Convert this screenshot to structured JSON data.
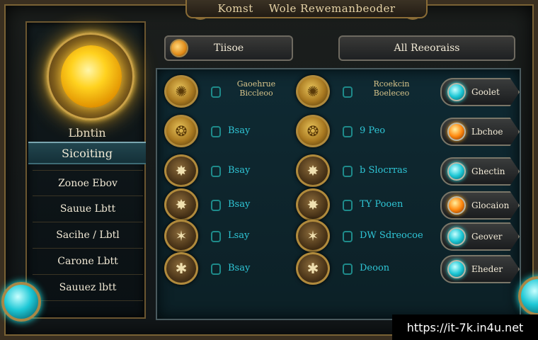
{
  "title": {
    "left": "Komst",
    "right": "Wole Rewemanbeoder"
  },
  "left_panel": {
    "heading": "Lbntin",
    "selected": "Sicoiting",
    "items": [
      {
        "label": "Zonoe Ebov"
      },
      {
        "label": "Sauue Lbtt"
      },
      {
        "label": "Sacihe / Lbtl"
      },
      {
        "label": "Carone Lbtt"
      },
      {
        "label": "Sauuez lbtt"
      }
    ]
  },
  "headers": {
    "left": "Tiisoe",
    "right": "All Reeoraiss"
  },
  "rows": [
    {
      "medal_a": "✺",
      "text_a": "Gaoehrue\nBiccleoo",
      "medal_b": "✺",
      "text_b": "Rcoekcin\nBoeleceo",
      "pill": "Goolet",
      "pill_gem": "teal"
    },
    {
      "medal_a": "❂",
      "text_a": "Bsay",
      "medal_b": "❂",
      "text_b": "9 Peo",
      "pill": "Lbchoe",
      "pill_gem": "amber"
    },
    {
      "medal_a": "✸",
      "text_a": "Bsay",
      "medal_b": "✸",
      "text_b": "b Slocrras",
      "pill": "Ghectin",
      "pill_gem": "teal"
    },
    {
      "medal_a": "✸",
      "text_a": "Bsay",
      "medal_b": "✸",
      "text_b": "TY Pooen",
      "pill": "Glocaion",
      "pill_gem": "amber"
    },
    {
      "medal_a": "✶",
      "text_a": "Lsay",
      "medal_b": "✶",
      "text_b": "DW Sdreocoe",
      "pill": "Geover",
      "pill_gem": "teal"
    },
    {
      "medal_a": "✱",
      "text_a": "Bsay",
      "medal_b": "✱",
      "text_b": "Deoon",
      "pill": "Eheder",
      "pill_gem": "teal"
    }
  ],
  "watermark": "https://it-7k.in4u.net"
}
